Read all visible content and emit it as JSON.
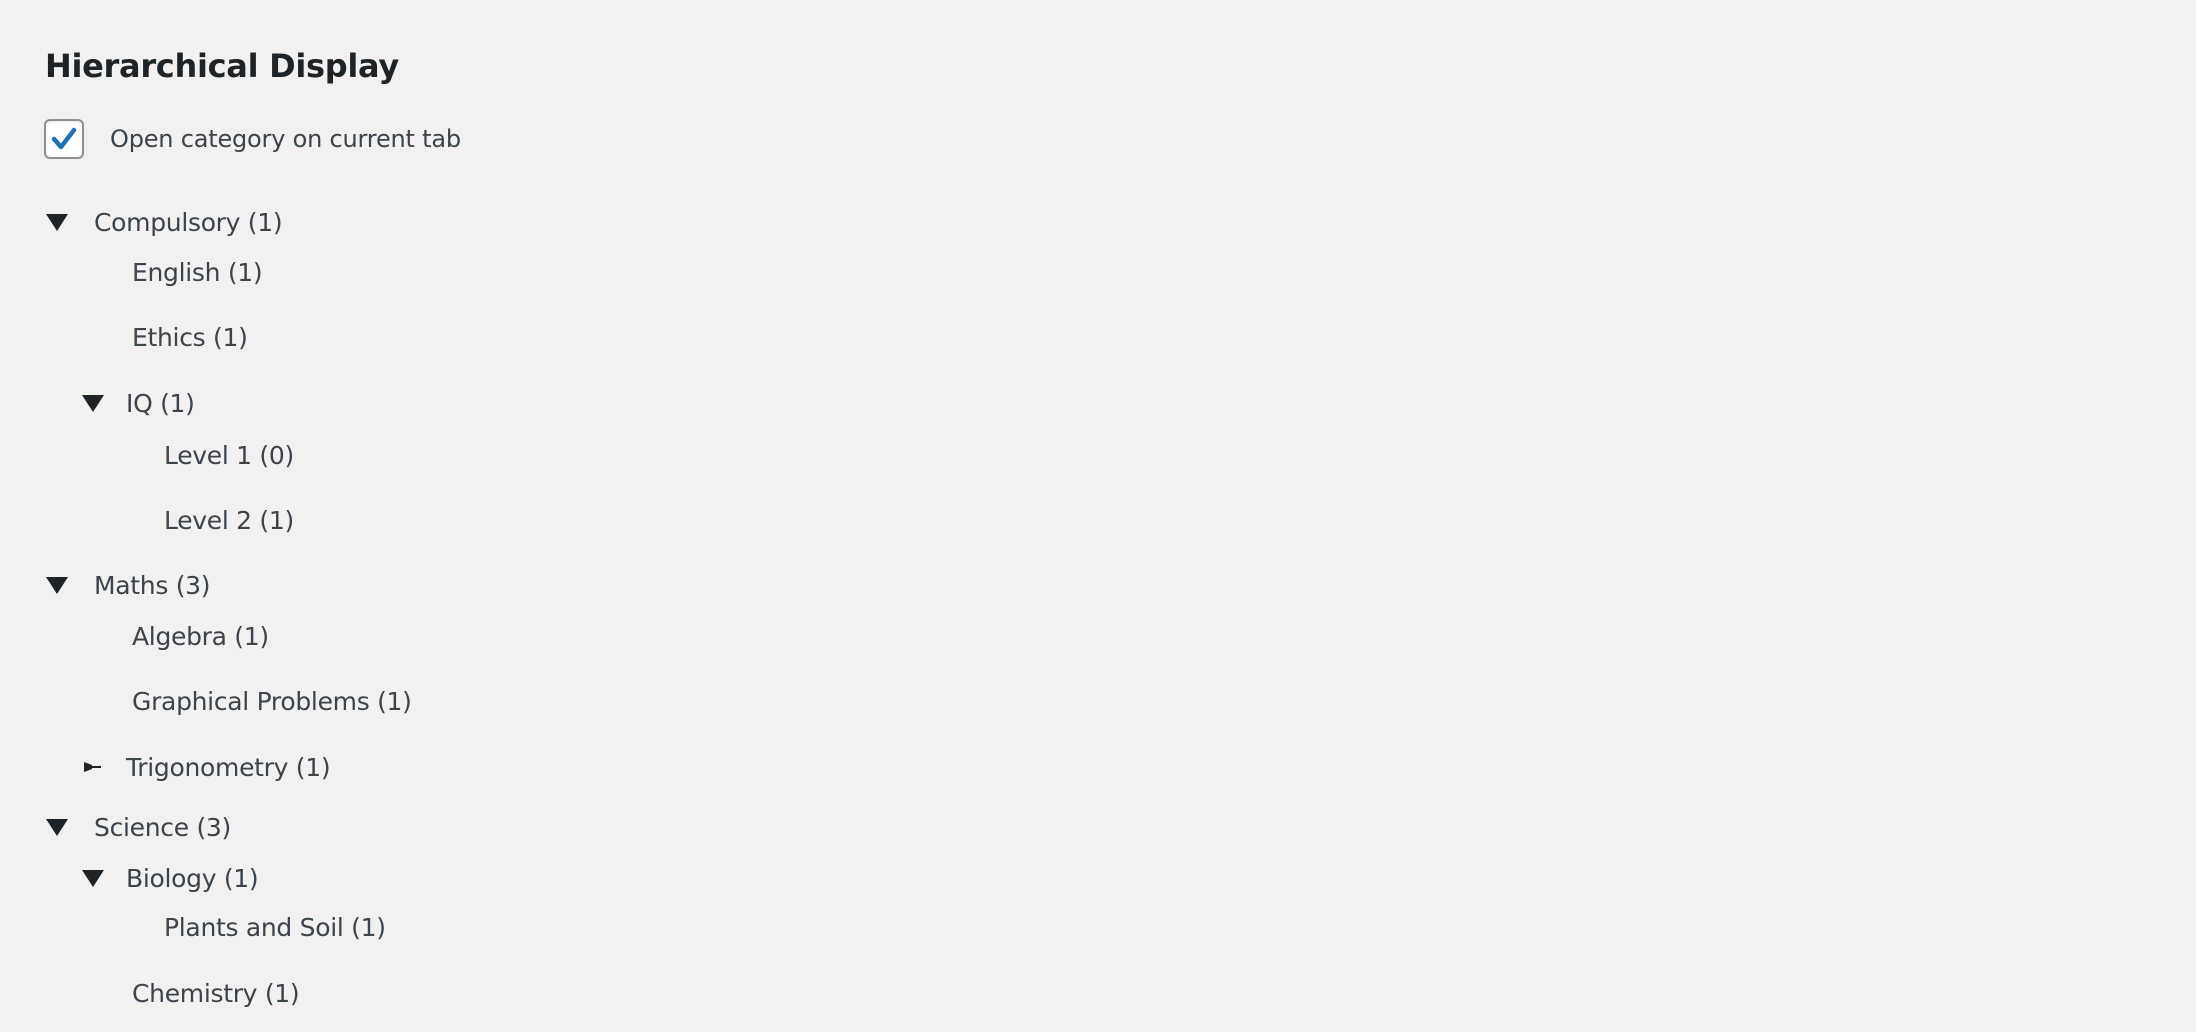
{
  "section": {
    "title": "Hierarchical Display"
  },
  "option": {
    "checked": true,
    "label": "Open category on current tab",
    "accent_color": "#2271b1"
  },
  "tree": [
    {
      "label": "Compulsory (1)",
      "level": 0,
      "toggle": "expanded"
    },
    {
      "label": "English (1)",
      "level": 1,
      "toggle": "none"
    },
    {
      "label": "Ethics (1)",
      "level": 1,
      "toggle": "none"
    },
    {
      "label": "IQ (1)",
      "level": 1,
      "toggle": "expanded"
    },
    {
      "label": "Level 1 (0)",
      "level": 2,
      "toggle": "none"
    },
    {
      "label": "Level 2 (1)",
      "level": 2,
      "toggle": "none"
    },
    {
      "label": "Maths (3)",
      "level": 0,
      "toggle": "expanded"
    },
    {
      "label": "Algebra (1)",
      "level": 1,
      "toggle": "none"
    },
    {
      "label": "Graphical Problems (1)",
      "level": 1,
      "toggle": "none"
    },
    {
      "label": "Trigonometry (1)",
      "level": 1,
      "toggle": "collapsed"
    },
    {
      "label": "Science (3)",
      "level": 0,
      "toggle": "expanded"
    },
    {
      "label": "Biology (1)",
      "level": 1,
      "toggle": "expanded"
    },
    {
      "label": "Plants and Soil (1)",
      "level": 2,
      "toggle": "none"
    },
    {
      "label": "Chemistry (1)",
      "level": 1,
      "toggle": "none"
    }
  ],
  "icons": {
    "expanded": "triangle-down-icon",
    "collapsed": "triangle-right-icon",
    "checkbox": "checkmark-icon"
  }
}
